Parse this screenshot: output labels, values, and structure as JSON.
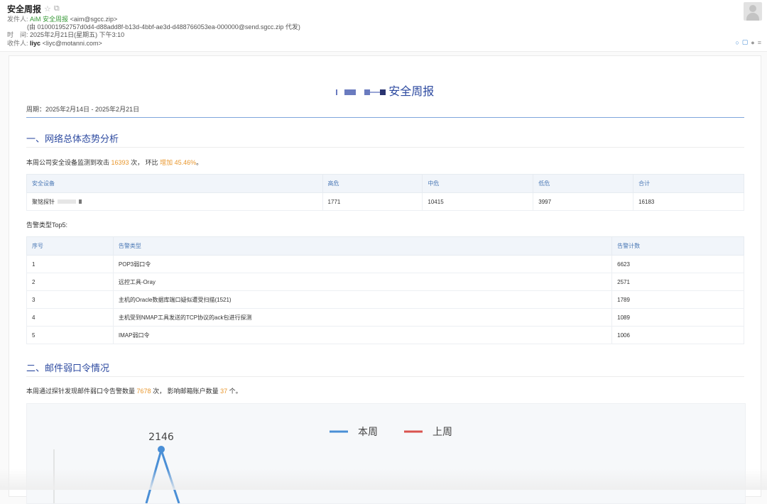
{
  "mail": {
    "subject": "安全周报",
    "from_label": "发件人:",
    "from_name": "AiM 安全周报",
    "from_email": "<aim@sgcc.zip>",
    "relay": "(由 010001952757d0d4-d88add8f-b13d-4bbf-ae3d-d488766053ea-000000@send.sgcc.zip 代发)",
    "time_label": "时　间:",
    "time_value": "2025年2月21日(星期五) 下午3:10",
    "to_label": "收件人:",
    "to_name": "liyc",
    "to_email": "<liyc@motanni.com>"
  },
  "report": {
    "title_suffix": "安全周报",
    "period": "周期：2025年2月14日 - 2025年2月21日",
    "section1": {
      "heading": "一、网络总体态势分析",
      "summary_pre": "本周公司安全设备监测到攻击",
      "attack_count": "16393",
      "summary_mid": "次， 环比",
      "change": "增加 45.46%",
      "summary_end": "。",
      "device_table": {
        "headers": [
          "安全设备",
          "高危",
          "中危",
          "低危",
          "合计"
        ],
        "rows": [
          {
            "device": "聚铭探针",
            "high": "1771",
            "medium": "10415",
            "low": "3997",
            "total": "16183"
          }
        ]
      },
      "top5_label": "告警类型Top5:",
      "alert_table": {
        "headers": [
          "序号",
          "告警类型",
          "告警计数"
        ],
        "rows": [
          {
            "no": "1",
            "type": "POP3弱口令",
            "count": "6623"
          },
          {
            "no": "2",
            "type": "远控工具-Oray",
            "count": "2571"
          },
          {
            "no": "3",
            "type": "主机的Oracle数据库端口疑似遭受扫描(1521)",
            "count": "1789"
          },
          {
            "no": "4",
            "type": "主机受到NMAP工具发送的TCP协议的ack包进行探测",
            "count": "1089"
          },
          {
            "no": "5",
            "type": "IMAP弱口令",
            "count": "1006"
          }
        ]
      }
    },
    "section2": {
      "heading": "二、邮件弱口令情况",
      "summary_pre": "本周通过探针发现邮件弱口令告警数量",
      "alert_count": "7678",
      "summary_mid": "次， 影响邮箱账户数量",
      "account_count": "37",
      "summary_end": "个。"
    }
  },
  "chart_data": {
    "type": "line",
    "series": [
      {
        "name": "本周",
        "color": "#4a8fd6",
        "visible_points": [
          {
            "label": "2146",
            "value": 2146
          }
        ]
      },
      {
        "name": "上周",
        "color": "#d9534f",
        "visible_points": []
      }
    ],
    "legend_position": "top-center"
  }
}
